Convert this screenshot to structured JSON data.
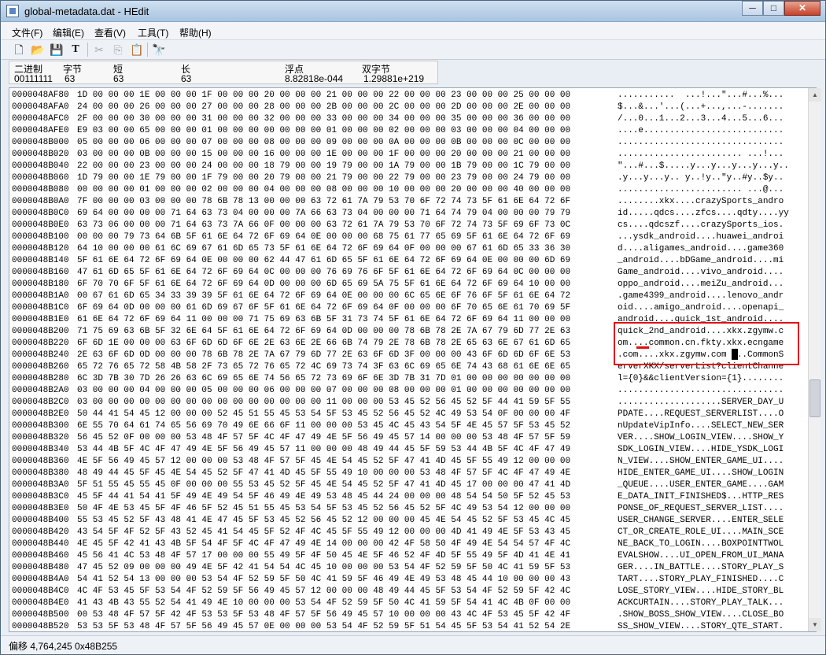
{
  "window": {
    "title": "global-metadata.dat - HEdit"
  },
  "window_controls": {
    "minimize": "─",
    "maximize": "□",
    "close": "✕"
  },
  "menu": [
    {
      "label": "文件(F)"
    },
    {
      "label": "编辑(E)"
    },
    {
      "label": "查看(V)"
    },
    {
      "label": "工具(T)"
    },
    {
      "label": "帮助(H)"
    }
  ],
  "toolbar": {
    "buttons": [
      {
        "icon": "new-file-icon",
        "glyph": "🗋",
        "enabled": true
      },
      {
        "icon": "open-folder-icon",
        "glyph": "📂",
        "enabled": true
      },
      {
        "icon": "save-icon",
        "glyph": "💾",
        "enabled": true
      },
      {
        "icon": "text-icon",
        "glyph": "T",
        "enabled": true
      },
      {
        "icon": "cut-icon",
        "glyph": "✂",
        "enabled": false
      },
      {
        "icon": "copy-icon",
        "glyph": "⎘",
        "enabled": false
      },
      {
        "icon": "paste-icon",
        "glyph": "📋",
        "enabled": true
      },
      {
        "icon": "find-icon",
        "glyph": "🔭",
        "enabled": true
      }
    ]
  },
  "inspector": {
    "labels": [
      "二进制",
      "字节",
      "短",
      "长",
      "浮点",
      "双字节"
    ],
    "values": [
      "00111111",
      "63",
      "63",
      "63",
      "8.82818e-044",
      "1.29881e+219"
    ]
  },
  "hex_rows": [
    {
      "offset": "0000048AF80",
      "hex": "1D 00 00 00 1E 00 00 00 1F 00 00 00 20 00 00 00 21 00 00 00 22 00 00 00 23 00 00 00 25 00 00 00",
      "ascii": "...........  ...!...\"...#...%..."
    },
    {
      "offset": "0000048AFA0",
      "hex": "24 00 00 00 26 00 00 00 27 00 00 00 28 00 00 00 2B 00 00 00 2C 00 00 00 2D 00 00 00 2E 00 00 00",
      "ascii": "$...&...'...(...+...,...-......."
    },
    {
      "offset": "0000048AFC0",
      "hex": "2F 00 00 00 30 00 00 00 31 00 00 00 32 00 00 00 33 00 00 00 34 00 00 00 35 00 00 00 36 00 00 00",
      "ascii": "/...0...1...2...3...4...5...6..."
    },
    {
      "offset": "0000048AFE0",
      "hex": "E9 03 00 00 65 00 00 00 01 00 00 00 00 00 00 00 01 00 00 00 02 00 00 00 03 00 00 00 04 00 00 00",
      "ascii": "....e..........................."
    },
    {
      "offset": "0000048B000",
      "hex": "05 00 00 00 06 00 00 00 07 00 00 00 08 00 00 00 09 00 00 00 0A 00 00 00 0B 00 00 00 0C 00 00 00",
      "ascii": "................................"
    },
    {
      "offset": "0000048B020",
      "hex": "03 00 00 00 0B 00 00 00 15 00 00 00 16 00 00 00 1E 00 00 00 1F 00 00 00 20 00 00 00 21 00 00 00",
      "ascii": "........................ ...!..."
    },
    {
      "offset": "0000048B040",
      "hex": "22 00 00 00 23 00 00 00 24 00 00 00 18 79 00 00 19 79 00 00 1A 79 00 00 1B 79 00 00 1C 79 00 00",
      "ascii": "\"...#...$.....y...y...y...y...y.."
    },
    {
      "offset": "0000048B060",
      "hex": "1D 79 00 00 1E 79 00 00 1F 79 00 00 20 79 00 00 21 79 00 00 22 79 00 00 23 79 00 00 24 79 00 00",
      "ascii": ".y...y...y.. y..!y..\"y..#y..$y.."
    },
    {
      "offset": "0000048B080",
      "hex": "00 00 00 00 01 00 00 00 02 00 00 00 04 00 00 00 08 00 00 00 10 00 00 00 20 00 00 00 40 00 00 00",
      "ascii": "........................ ...@..."
    },
    {
      "offset": "0000048B0A0",
      "hex": "7F 00 00 00 03 00 00 00 78 6B 78 13 00 00 00 63 72 61 7A 79 53 70 6F 72 74 73 5F 61 6E 64 72 6F",
      "ascii": "........xkx....crazySports_andro"
    },
    {
      "offset": "0000048B0C0",
      "hex": "69 64 00 00 00 00 71 64 63 73 04 00 00 00 7A 66 63 73 04 00 00 00 71 64 74 79 04 00 00 00 79 79",
      "ascii": "id.....qdcs....zfcs....qdty....yy"
    },
    {
      "offset": "0000048B0E0",
      "hex": "63 73 06 00 00 00 71 64 63 73 7A 66 0F 00 00 00 63 72 61 7A 79 53 70 6F 72 74 73 5F 69 6F 73 0C",
      "ascii": "cs....qdcszf....crazySports_ios."
    },
    {
      "offset": "0000048B100",
      "hex": "00 00 00 79 73 64 6B 5F 61 6E 64 72 6F 69 64 0E 00 00 00 68 75 61 77 65 69 5F 61 6E 64 72 6F 69",
      "ascii": "...ysdk_android....huawei_androi"
    },
    {
      "offset": "0000048B120",
      "hex": "64 10 00 00 00 61 6C 69 67 61 6D 65 73 5F 61 6E 64 72 6F 69 64 0F 00 00 00 67 61 6D 65 33 36 30",
      "ascii": "d....aligames_android....game360"
    },
    {
      "offset": "0000048B140",
      "hex": "5F 61 6E 64 72 6F 69 64 0E 00 00 00 62 44 47 61 6D 65 5F 61 6E 64 72 6F 69 64 0E 00 00 00 6D 69",
      "ascii": "_android....bDGame_android....mi"
    },
    {
      "offset": "0000048B160",
      "hex": "47 61 6D 65 5F 61 6E 64 72 6F 69 64 0C 00 00 00 76 69 76 6F 5F 61 6E 64 72 6F 69 64 0C 00 00 00",
      "ascii": "Game_android....vivo_android...."
    },
    {
      "offset": "0000048B180",
      "hex": "6F 70 70 6F 5F 61 6E 64 72 6F 69 64 0D 00 00 00 6D 65 69 5A 75 5F 61 6E 64 72 6F 69 64 10 00 00",
      "ascii": "oppo_android....meiZu_android..."
    },
    {
      "offset": "0000048B1A0",
      "hex": "00 67 61 6D 65 34 33 39 39 5F 61 6E 64 72 6F 69 64 0E 00 00 00 6C 65 6E 6F 76 6F 5F 61 6E 64 72",
      "ascii": ".game4399_android....lenovo_andr"
    },
    {
      "offset": "0000048B1C0",
      "hex": "6F 69 64 0D 00 00 00 61 6D 69 67 6F 5F 61 6E 64 72 6F 69 64 0F 00 00 00 6F 70 65 6E 61 70 69 5F",
      "ascii": "oid....amigo_android....openapi_"
    },
    {
      "offset": "0000048B1E0",
      "hex": "61 6E 64 72 6F 69 64 11 00 00 00 71 75 69 63 6B 5F 31 73 74 5F 61 6E 64 72 6F 69 64 11 00 00 00",
      "ascii": "android....quick_1st_android...."
    },
    {
      "offset": "0000048B200",
      "hex": "71 75 69 63 6B 5F 32 6E 64 5F 61 6E 64 72 6F 69 64 0D 00 00 00 78 6B 78 2E 7A 67 79 6D 77 2E 63",
      "ascii": "quick_2nd_android....xkx.zgymw.c"
    },
    {
      "offset": "0000048B220",
      "hex": "6F 6D 1E 00 00 00 63 6F 6D 6D 6F 6E 2E 63 6E 2E 66 6B 74 79 2E 78 6B 78 2E 65 63 6E 67 61 6D 65",
      "ascii": "om....common.cn.fkty.xkx.ecngame"
    },
    {
      "offset": "0000048B240",
      "hex": "2E 63 6F 6D 0D 00 00 00 78 6B 78 2E 7A 67 79 6D 77 2E 63 6F 6D 3F 00 00 00 43 6F 6D 6D 6F 6E 53",
      "ascii": ".com....xkx.zgymw.com ...CommonS"
    },
    {
      "offset": "0000048B260",
      "hex": "65 72 76 65 72 58 4B 58 2F 73 65 72 76 65 72 4C 69 73 74 3F 63 6C 69 65 6E 74 43 68 61 6E 6E 65",
      "ascii": "erverXKX/serverList?clientChanne"
    },
    {
      "offset": "0000048B280",
      "hex": "6C 3D 7B 30 7D 26 26 63 6C 69 65 6E 74 56 65 72 73 69 6F 6E 3D 7B 31 7D 01 00 00 00 00 00 00 00",
      "ascii": "l={0}&&clientVersion={1}........"
    },
    {
      "offset": "0000048B2A0",
      "hex": "03 00 00 00 04 00 00 00 05 00 00 00 06 00 00 00 07 00 00 00 08 00 00 00 01 00 00 00 00 00 00 00",
      "ascii": "................................"
    },
    {
      "offset": "0000048B2C0",
      "hex": "03 00 00 00 00 00 00 00 00 00 00 00 00 00 00 00 11 00 00 00 53 45 52 56 45 52 5F 44 41 59 5F 55",
      "ascii": "....................SERVER_DAY_U"
    },
    {
      "offset": "0000048B2E0",
      "hex": "50 44 41 54 45 12 00 00 00 52 45 51 55 45 53 54 5F 53 45 52 56 45 52 4C 49 53 54 0F 00 00 00 4F",
      "ascii": "PDATE....REQUEST_SERVERLIST....O"
    },
    {
      "offset": "0000048B300",
      "hex": "6E 55 70 64 61 74 65 56 69 70 49 6E 66 6F 11 00 00 00 53 45 4C 45 43 54 5F 4E 45 57 5F 53 45 52",
      "ascii": "nUpdateVipInfo....SELECT_NEW_SER"
    },
    {
      "offset": "0000048B320",
      "hex": "56 45 52 0F 00 00 00 53 48 4F 57 5F 4C 4F 47 49 4E 5F 56 49 45 57 14 00 00 00 53 48 4F 57 5F 59",
      "ascii": "VER....SHOW_LOGIN_VIEW....SHOW_Y"
    },
    {
      "offset": "0000048B340",
      "hex": "53 44 4B 5F 4C 4F 47 49 4E 5F 56 49 45 57 11 00 00 00 48 49 44 45 5F 59 53 44 4B 5F 4C 4F 47 49",
      "ascii": "SDK_LOGIN_VIEW....HIDE_YSDK_LOGI"
    },
    {
      "offset": "0000048B360",
      "hex": "4E 5F 56 49 45 57 12 00 00 00 53 48 4F 57 5F 45 4E 54 45 52 5F 47 41 4D 45 5F 55 49 12 00 00 00",
      "ascii": "N_VIEW....SHOW_ENTER_GAME_UI...."
    },
    {
      "offset": "0000048B380",
      "hex": "48 49 44 45 5F 45 4E 54 45 52 5F 47 41 4D 45 5F 55 49 10 00 00 00 53 48 4F 57 5F 4C 4F 47 49 4E",
      "ascii": "HIDE_ENTER_GAME_UI....SHOW_LOGIN"
    },
    {
      "offset": "0000048B3A0",
      "hex": "5F 51 55 45 55 45 0F 00 00 00 55 53 45 52 5F 45 4E 54 45 52 5F 47 41 4D 45 17 00 00 00 47 41 4D",
      "ascii": "_QUEUE....USER_ENTER_GAME....GAM"
    },
    {
      "offset": "0000048B3C0",
      "hex": "45 5F 44 41 54 41 5F 49 4E 49 54 5F 46 49 4E 49 53 48 45 44 24 00 00 00 48 54 54 50 5F 52 45 53",
      "ascii": "E_DATA_INIT_FINISHED$...HTTP_RES"
    },
    {
      "offset": "0000048B3E0",
      "hex": "50 4F 4E 53 45 5F 4F 46 5F 52 45 51 55 45 53 54 5F 53 45 52 56 45 52 5F 4C 49 53 54 12 00 00 00",
      "ascii": "PONSE_OF_REQUEST_SERVER_LIST...."
    },
    {
      "offset": "0000048B400",
      "hex": "55 53 45 52 5F 43 48 41 4E 47 45 5F 53 45 52 56 45 52 12 00 00 00 45 4E 54 45 52 5F 53 45 4C 45",
      "ascii": "USER_CHANGE_SERVER....ENTER_SELE"
    },
    {
      "offset": "0000048B420",
      "hex": "43 54 5F 4F 52 5F 43 52 45 41 54 45 5F 52 4F 4C 45 5F 55 49 12 00 00 00 4D 41 49 4E 5F 53 43 45",
      "ascii": "CT_OR_CREATE_ROLE_UI....MAIN_SCE"
    },
    {
      "offset": "0000048B440",
      "hex": "4E 45 5F 42 41 43 4B 5F 54 4F 5F 4C 4F 47 49 4E 14 00 00 00 42 4F 58 50 4F 49 4E 54 54 57 4F 4C",
      "ascii": "NE_BACK_TO_LOGIN....BOXPOINTTWOL"
    },
    {
      "offset": "0000048B460",
      "hex": "45 56 41 4C 53 48 4F 57 17 00 00 00 55 49 5F 4F 50 45 4E 5F 46 52 4F 4D 5F 55 49 5F 4D 41 4E 41",
      "ascii": "EVALSHOW....UI_OPEN_FROM_UI_MANA"
    },
    {
      "offset": "0000048B480",
      "hex": "47 45 52 09 00 00 00 49 4E 5F 42 41 54 54 4C 45 10 00 00 00 53 54 4F 52 59 5F 50 4C 41 59 5F 53",
      "ascii": "GER....IN_BATTLE....STORY_PLAY_S"
    },
    {
      "offset": "0000048B4A0",
      "hex": "54 41 52 54 13 00 00 00 53 54 4F 52 59 5F 50 4C 41 59 5F 46 49 4E 49 53 48 45 44 10 00 00 00 43",
      "ascii": "TART....STORY_PLAY_FINISHED....C"
    },
    {
      "offset": "0000048B4C0",
      "hex": "4C 4F 53 45 5F 53 54 4F 52 59 5F 56 49 45 57 12 00 00 00 48 49 44 45 5F 53 54 4F 52 59 5F 42 4C",
      "ascii": "LOSE_STORY_VIEW....HIDE_STORY_BL"
    },
    {
      "offset": "0000048B4E0",
      "hex": "41 43 4B 43 55 52 54 41 49 4E 10 00 00 00 53 54 4F 52 59 5F 50 4C 41 59 5F 54 41 4C 4B 0F 00 00",
      "ascii": "ACKCURTAIN....STORY_PLAY_TALK..."
    },
    {
      "offset": "0000048B500",
      "hex": "00 53 48 4F 57 5F 42 4F 53 53 5F 53 48 4F 57 5F 56 49 45 57 10 00 00 00 43 4C 4F 53 45 5F 42 4F",
      "ascii": ".SHOW_BOSS_SHOW_VIEW....CLOSE_BO"
    },
    {
      "offset": "0000048B520",
      "hex": "53 53 5F 53 48 4F 57 5F 56 49 45 57 0E 00 00 00 53 54 4F 52 59 5F 51 54 45 5F 53 54 41 52 54 2E",
      "ascii": "SS_SHOW_VIEW....STORY_QTE_START."
    }
  ],
  "status": {
    "text": "偏移 4,764,245 0x48B255"
  }
}
